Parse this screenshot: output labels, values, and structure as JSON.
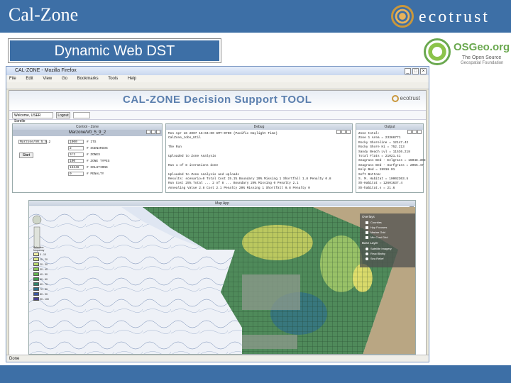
{
  "slide": {
    "title": "Cal-Zone",
    "subtitle": "Dynamic Web DST",
    "ecotrust": "ecotrust",
    "osgeo": {
      "name": "OSGeo.org",
      "tagline1": "The Open Source",
      "tagline2": "Geospatial Foundation"
    }
  },
  "browser": {
    "title": "CAL-ZONE - Mozilla Firefox",
    "menu": [
      "File",
      "Edit",
      "View",
      "Go",
      "Bookmarks",
      "Tools",
      "Help"
    ],
    "status": "Done"
  },
  "app": {
    "title": "CAL-ZONE Decision Support TOOL",
    "logo": "ecotrust",
    "user_field": "Welcome, USER Sorelle",
    "logout": "Logout"
  },
  "control_panel": {
    "title": "Control - Zone",
    "subtitle": "Marzone/V0_5_9_2",
    "scenario_value": "Marzone/V0_5_9_2",
    "fields": [
      {
        "value": "1000",
        "label": "# ITS"
      },
      {
        "value": "2",
        "label": "# SCENARIOS"
      },
      {
        "value": "3/2",
        "label": "# ZONES"
      },
      {
        "value": "100",
        "label": "# ZONE TYPES"
      },
      {
        "value": "16346",
        "label": "# SOLUTIONS"
      },
      {
        "value": "0",
        "label": "# PENALTY"
      }
    ],
    "start": "Start"
  },
  "debug_panel": {
    "title": "Debug",
    "lines": [
      "Mon Apr 16 2007 16:04:00 GMT-0700 (Pacific Daylight Time)",
      "CalZone_Jobs_Util",
      "",
      "The Run",
      "",
      "Uploaded to Zone Analysis",
      "",
      "Run 1 of 8 iterations done",
      "",
      "Uploaded to Zone Analysis and uploads",
      "Results: scenario=0 Total Cost 25.1% Boundary 20% Missing 1 Shortfall 1.8 Penalty 0.8",
      "Run Cost 25% Total ... 2 of 8 ... Boundary 20% Missing 0 Penalty 2.1",
      "Annealing Value 2.8 Cost 2.1 Penalty 20% Missing 1 Shortfall 0.8 Penalty 0"
    ]
  },
  "output_panel": {
    "title": "Output",
    "lines": [
      "Zone total:",
      "Zone 1 Area = 23366771",
      "Rocky Shoreline = 12147.42",
      "Rocky Shore Hi = 752.213",
      "Sandy Beach Lvl = 11536.218",
      "Total Flats = 21021.41",
      "Seagrass Bed - Eelgrass = 16048.303",
      "Seagrass Bed - Surfgrass = 2065.47",
      "Kelp Bed = 19916.01",
      "Soft Bottom:",
      "S. M. Habitat = 10002303.5",
      "Sh-Habitat = 12601637.4",
      "Sh-habitat.s = 21.6"
    ]
  },
  "map_panel": {
    "title": "Map App",
    "legend_title": "Selection frequency",
    "legend": [
      {
        "label": "0 - 10",
        "color": "#f2f2a8"
      },
      {
        "label": "10 - 20",
        "color": "#dde98a"
      },
      {
        "label": "20 - 30",
        "color": "#b8d96c"
      },
      {
        "label": "30 - 40",
        "color": "#8cc75a"
      },
      {
        "label": "40 - 50",
        "color": "#5fb24c"
      },
      {
        "label": "50 - 60",
        "color": "#3d9b4c"
      },
      {
        "label": "60 - 70",
        "color": "#2f8068"
      },
      {
        "label": "70 - 80",
        "color": "#2f6f8c"
      },
      {
        "label": "80 - 90",
        "color": "#3a569f"
      },
      {
        "label": "90 - 100",
        "color": "#4a3f93"
      }
    ],
    "layers_title": "Overlays",
    "overlays": [
      "Counties",
      "Hyp Focuses",
      "Marine Grid",
      "Min Cost Grid"
    ],
    "base_title": "Base Layer",
    "bases": [
      "Satellite Imagery",
      "Read Bathy",
      "Sea Relief"
    ]
  }
}
